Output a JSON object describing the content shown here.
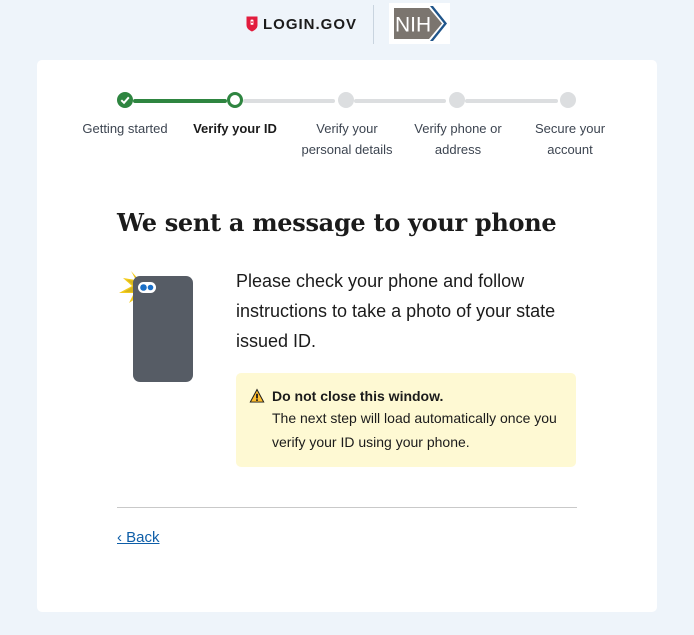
{
  "header": {
    "login_logo_text": "LOGIN.GOV",
    "partner_logo_text": "NIH"
  },
  "steps": [
    {
      "label_line1": "Getting started",
      "label_line2": "",
      "status": "complete"
    },
    {
      "label_line1": "Verify your ID",
      "label_line2": "",
      "status": "current"
    },
    {
      "label_line1": "Verify your",
      "label_line2": "personal details",
      "status": "pending"
    },
    {
      "label_line1": "Verify phone or",
      "label_line2": "address",
      "status": "pending"
    },
    {
      "label_line1": "Secure your",
      "label_line2": "account",
      "status": "pending"
    }
  ],
  "main": {
    "title": "We sent a message to your phone",
    "instructions": "Please check your phone and follow instructions to take a photo of your state issued ID.",
    "alert": {
      "heading": "Do not close this window.",
      "body": "The next step will load automatically once you verify your ID using your phone."
    },
    "back_link": "‹ Back"
  },
  "colors": {
    "page_background": "#eef4fa",
    "step_complete": "#2e8540",
    "step_pending": "#dcdee0",
    "alert_background": "#fef9d3",
    "alert_icon": "#ffbe2e",
    "link": "#0e5ea8",
    "brand_red": "#e21c3d",
    "nih_blue": "#20558a"
  },
  "icons": {
    "step_complete": "checkmark-icon",
    "alert": "warning-icon",
    "brand": "shield-icon",
    "illustration": "phone-with-flash-icon"
  }
}
